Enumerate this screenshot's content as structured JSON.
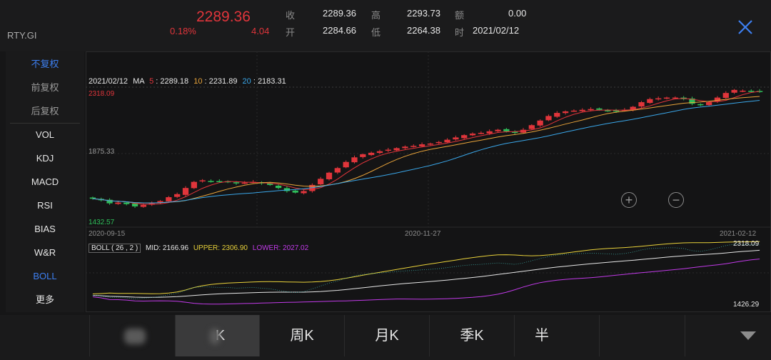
{
  "header": {
    "symbol": "RTY.GI",
    "last_price": "2289.36",
    "change_pct": "0.18%",
    "change_abs": "4.04",
    "close_label": "收",
    "close_value": "2289.36",
    "open_label": "开",
    "open_value": "2284.66",
    "high_label": "高",
    "high_value": "2293.73",
    "low_label": "低",
    "low_value": "2264.38",
    "amount_label": "额",
    "amount_value": "0.00",
    "time_label": "时",
    "time_value": "2021/02/12"
  },
  "sidebar": {
    "items": [
      {
        "label": "不复权",
        "state": "active"
      },
      {
        "label": "前复权",
        "state": "inactive"
      },
      {
        "label": "后复权",
        "state": "inactive"
      },
      {
        "label": "VOL",
        "state": "normal"
      },
      {
        "label": "KDJ",
        "state": "normal"
      },
      {
        "label": "MACD",
        "state": "normal"
      },
      {
        "label": "RSI",
        "state": "normal"
      },
      {
        "label": "BIAS",
        "state": "normal"
      },
      {
        "label": "W&R",
        "state": "normal"
      },
      {
        "label": "BOLL",
        "state": "active"
      },
      {
        "label": "更多",
        "state": "normal"
      }
    ]
  },
  "main_chart": {
    "ma_date": "2021/02/12",
    "ma_label": "MA",
    "ma5_period": "5",
    "ma5_value": "2289.18",
    "ma10_period": "10",
    "ma10_value": "2231.89",
    "ma20_period": "20",
    "ma20_value": "2183.31",
    "y_top": "2318.09",
    "y_mid": "1875.33",
    "y_bottom": "1432.57",
    "x_labels": [
      "2020-09-15",
      "2020-11-27",
      "2021-02-12"
    ],
    "zoom_in": "+",
    "zoom_out": "−"
  },
  "boll": {
    "label": "BOLL ( 26 , 2 )",
    "mid_label": "MID: 2166.96",
    "upper_label": "UPPER: 2306.90",
    "lower_label": "LOWER: 2027.02",
    "y_top": "2318.09",
    "y_bottom": "1426.29"
  },
  "tabs": [
    {
      "label": "",
      "blurred": false
    },
    {
      "label": "",
      "blurred": true
    },
    {
      "label": "K",
      "blurred": true,
      "active": true
    },
    {
      "label": "周K"
    },
    {
      "label": "月K"
    },
    {
      "label": "季K"
    },
    {
      "label": "半",
      "clipped": true
    },
    {
      "label": "",
      "blurred": false
    },
    {
      "label": "",
      "blurred": false
    }
  ],
  "colors": {
    "up": "#e0353b",
    "down": "#2fbf5a",
    "ma5": "#e0353b",
    "ma10": "#e8a33a",
    "ma20": "#3aa6e8",
    "boll_mid": "#e6e6e6",
    "boll_upper": "#e8d13a",
    "boll_lower": "#c13ae8",
    "accent": "#3d7ff0"
  },
  "chart_data": {
    "type": "candlestick",
    "x_range": [
      "2020-09-15",
      "2021-02-12"
    ],
    "ylim": [
      1432.57,
      2318.09
    ],
    "close_approx": [
      1590,
      1580,
      1560,
      1565,
      1555,
      1540,
      1550,
      1560,
      1575,
      1600,
      1620,
      1660,
      1700,
      1710,
      1705,
      1700,
      1700,
      1690,
      1695,
      1700,
      1690,
      1680,
      1660,
      1640,
      1630,
      1640,
      1680,
      1720,
      1760,
      1790,
      1830,
      1860,
      1880,
      1890,
      1900,
      1910,
      1920,
      1930,
      1935,
      1945,
      1950,
      1960,
      1975,
      1990,
      2005,
      2015,
      2020,
      2030,
      2040,
      2030,
      2020,
      2040,
      2070,
      2100,
      2130,
      2150,
      2160,
      2165,
      2170,
      2175,
      2170,
      2165,
      2160,
      2170,
      2190,
      2220,
      2240,
      2245,
      2250,
      2250,
      2240,
      2210,
      2200,
      2220,
      2250,
      2280,
      2300,
      2295,
      2290,
      2289
    ]
  }
}
